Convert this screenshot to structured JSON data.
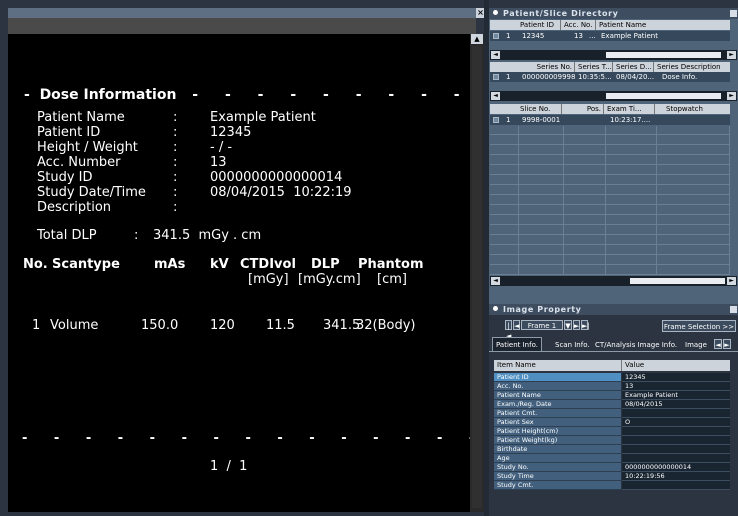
{
  "report": {
    "heading": "Dose Information",
    "fields": [
      {
        "label": "Patient Name",
        "sep": ":",
        "value": "Example Patient"
      },
      {
        "label": "Patient ID",
        "sep": ":",
        "value": "12345"
      },
      {
        "label": "Height / Weight",
        "sep": ":",
        "value": "- / -"
      },
      {
        "label": "Acc. Number",
        "sep": ":",
        "value": "13"
      },
      {
        "label": "Study ID",
        "sep": ":",
        "value": "0000000000000014"
      },
      {
        "label": "Study Date/Time",
        "sep": ":",
        "value": "08/04/2015  10:22:19"
      },
      {
        "label": "Description",
        "sep": ":",
        "value": ""
      }
    ],
    "total_dlp_label": "Total DLP",
    "total_dlp_sep": ":",
    "total_dlp_value": "341.5  mGy . cm",
    "columns": {
      "no": "No.",
      "scantype": "Scantype",
      "mas": "mAs",
      "kv": "kV",
      "ctdivol": "CTDIvol",
      "ctdivol_unit": "[mGy]",
      "dlp": "DLP",
      "dlp_unit": "[mGy.cm]",
      "phantom": "Phantom",
      "phantom_unit": "[cm]"
    },
    "rows": [
      {
        "no": "1",
        "scantype": "Volume",
        "mas": "150.0",
        "kv": "120",
        "ctdivol": "11.5",
        "dlp": "341.5",
        "phantom": "32(Body)"
      }
    ],
    "page": "1  /  1"
  },
  "directory": {
    "title": "Patient/Slice Directory",
    "patient_headers": [
      "Patient ID",
      "Acc. No.",
      "Patient Name"
    ],
    "patient_rows": [
      {
        "num": "1",
        "id": "12345",
        "acc": "13",
        "acc_more": "...",
        "name": "Example Patient"
      }
    ],
    "series_headers": [
      "Series No.",
      "Series T...",
      "Series D...",
      "Series Description"
    ],
    "series_rows": [
      {
        "num": "1",
        "no": "000000009998",
        "time": "10:35:5...",
        "date": "08/04/20...",
        "desc": "Dose Info."
      }
    ],
    "slice_headers": [
      "Slice No.",
      "Pos.",
      "Exam Ti...",
      "Stopwatch"
    ],
    "slice_rows": [
      {
        "num": "1",
        "no": "9998-0001",
        "pos": "",
        "time": "10:23:17....",
        "stopwatch": ""
      }
    ],
    "scroll_left": "◄",
    "scroll_right": "►"
  },
  "image_property": {
    "title": "Image Property",
    "frame_label": "Frame 1",
    "frame_selection": "Frame Selection >>",
    "tabs": [
      "Patient Info.",
      "Scan Info.",
      "CT/Analysis Image Info.",
      "Image"
    ],
    "active_tab": "Patient Info.",
    "headers": {
      "name": "Item Name",
      "value": "Value"
    },
    "items": [
      {
        "name": "Patient ID",
        "value": "12345"
      },
      {
        "name": "Acc. No.",
        "value": "13"
      },
      {
        "name": "Patient Name",
        "value": "Example Patient"
      },
      {
        "name": "Exam./Reg. Date",
        "value": "08/04/2015"
      },
      {
        "name": "Patient Cmt.",
        "value": ""
      },
      {
        "name": "Patient Sex",
        "value": "O"
      },
      {
        "name": "Patient Height(cm)",
        "value": ""
      },
      {
        "name": "Patient Weight(kg)",
        "value": ""
      },
      {
        "name": "Birthdate",
        "value": ""
      },
      {
        "name": "Age",
        "value": ""
      },
      {
        "name": "Study No.",
        "value": "0000000000000014"
      },
      {
        "name": "Study Time",
        "value": "10:22:19:56"
      },
      {
        "name": "Study Cmt.",
        "value": ""
      }
    ]
  },
  "icons": {
    "close": "close-icon",
    "collapse": "minimize-icon"
  },
  "colors": {
    "report_bg": "#000000",
    "panel_bg": "#506479",
    "highlight": "#4f8fc2"
  }
}
